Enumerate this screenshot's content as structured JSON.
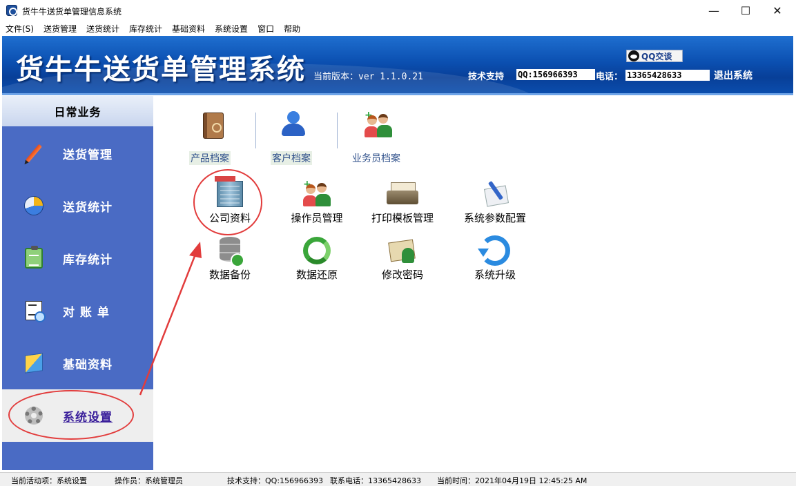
{
  "window": {
    "title": "货牛牛送货单管理信息系统",
    "minimize": "—",
    "maximize": "☐",
    "close": "✕"
  },
  "menu": [
    "文件(S)",
    "送货管理",
    "送货统计",
    "库存统计",
    "基础资料",
    "系统设置",
    "窗口",
    "帮助"
  ],
  "banner": {
    "title": "货牛牛送货单管理系统",
    "version": "当前版本：ver 1.1.0.21",
    "qq_button": "QQ交谈",
    "support_label": "技术支持",
    "qq_value": "QQ:156966393",
    "phone_label": "电话：",
    "phone_value": "13365428633",
    "logout": "退出系统"
  },
  "sidebar": {
    "header": "日常业务",
    "items": [
      {
        "label": "送货管理",
        "icon": "pencil-icon"
      },
      {
        "label": "送货统计",
        "icon": "pie-chart-icon"
      },
      {
        "label": "库存统计",
        "icon": "clipboard-icon"
      },
      {
        "label": "对 账 单",
        "icon": "document-search-icon"
      },
      {
        "label": "基础资料",
        "icon": "box-icon"
      },
      {
        "label": "系统设置",
        "icon": "gear-icon",
        "active": true
      }
    ]
  },
  "shortcuts": [
    {
      "label": "产品档案",
      "icon": "book-icon"
    },
    {
      "label": "客户档案",
      "icon": "people-icon"
    },
    {
      "label": "业务员档案",
      "icon": "staff-icon"
    }
  ],
  "tiles": [
    {
      "label": "公司资料",
      "icon": "building-icon"
    },
    {
      "label": "操作员管理",
      "icon": "operators-icon"
    },
    {
      "label": "打印模板管理",
      "icon": "printer-icon"
    },
    {
      "label": "系统参数配置",
      "icon": "settings-pen-icon"
    },
    {
      "label": "数据备份",
      "icon": "database-icon"
    },
    {
      "label": "数据还原",
      "icon": "recycle-icon"
    },
    {
      "label": "修改密码",
      "icon": "password-icon"
    },
    {
      "label": "系统升级",
      "icon": "upgrade-icon"
    }
  ],
  "status": {
    "activity": "当前活动项：系统设置",
    "operator": "操作员：系统管理员",
    "support": "技术支持：QQ:156966393",
    "phone": "联系电话：13365428633",
    "time": "当前时间：2021年04月19日 12:45:25 AM"
  },
  "colors": {
    "banner_blue": "#0b4fb0",
    "sidebar_blue": "#4a6bc4",
    "annotation_red": "#e23c3c"
  }
}
